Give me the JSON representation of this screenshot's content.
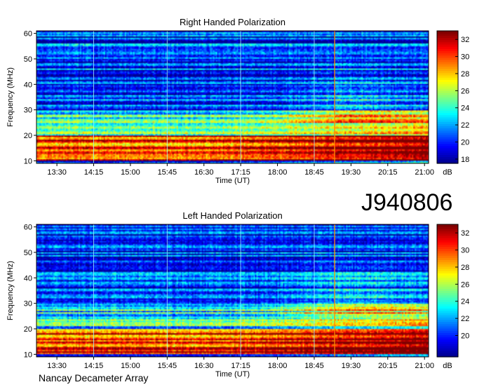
{
  "observation_id": "J940806",
  "credit": "Nancay Decameter Array",
  "colorbar": {
    "unit": "dB",
    "ticks": [
      18,
      20,
      22,
      24,
      26,
      28,
      30,
      32
    ],
    "range": [
      17.5,
      33
    ],
    "colors": [
      "#00008f",
      "#0000ff",
      "#007fff",
      "#00ffff",
      "#7fff7f",
      "#ffff00",
      "#ff7f00",
      "#ff0000",
      "#7f0000"
    ]
  },
  "chart_data": [
    {
      "type": "heatmap",
      "title": "Right Handed Polarization",
      "xlabel": "Time (UT)",
      "ylabel": "Frequency (MHz)",
      "x_ticks": [
        "13:30",
        "14:15",
        "15:00",
        "15:45",
        "16:30",
        "17:15",
        "18:00",
        "18:45",
        "19:30",
        "20:15",
        "21:00"
      ],
      "y_ticks": [
        10,
        20,
        30,
        40,
        50,
        60
      ],
      "xlim": [
        "13:05",
        "21:05"
      ],
      "ylim": [
        9,
        61
      ],
      "value_unit": "dB",
      "value_range": [
        18,
        32
      ],
      "description_levels": [
        {
          "frequency_band": [
            10,
            20
          ],
          "level_db": 30
        },
        {
          "frequency_band": [
            20,
            30
          ],
          "level_db": 24
        },
        {
          "frequency_band": [
            30,
            60
          ],
          "level_db": 20
        }
      ]
    },
    {
      "type": "heatmap",
      "title": "Left Handed Polarization",
      "xlabel": "Time (UT)",
      "ylabel": "Frequency (MHz)",
      "x_ticks": [
        "13:30",
        "14:15",
        "15:00",
        "15:45",
        "16:30",
        "17:15",
        "18:00",
        "18:45",
        "19:30",
        "20:15",
        "21:00"
      ],
      "y_ticks": [
        10,
        20,
        30,
        40,
        50,
        60
      ],
      "xlim": [
        "13:05",
        "21:05"
      ],
      "ylim": [
        9,
        61
      ],
      "value_unit": "dB",
      "value_range": [
        18,
        32
      ],
      "description_levels": [
        {
          "frequency_band": [
            10,
            20
          ],
          "level_db": 30
        },
        {
          "frequency_band": [
            20,
            30
          ],
          "level_db": 23
        },
        {
          "frequency_band": [
            30,
            60
          ],
          "level_db": 20
        }
      ]
    }
  ]
}
